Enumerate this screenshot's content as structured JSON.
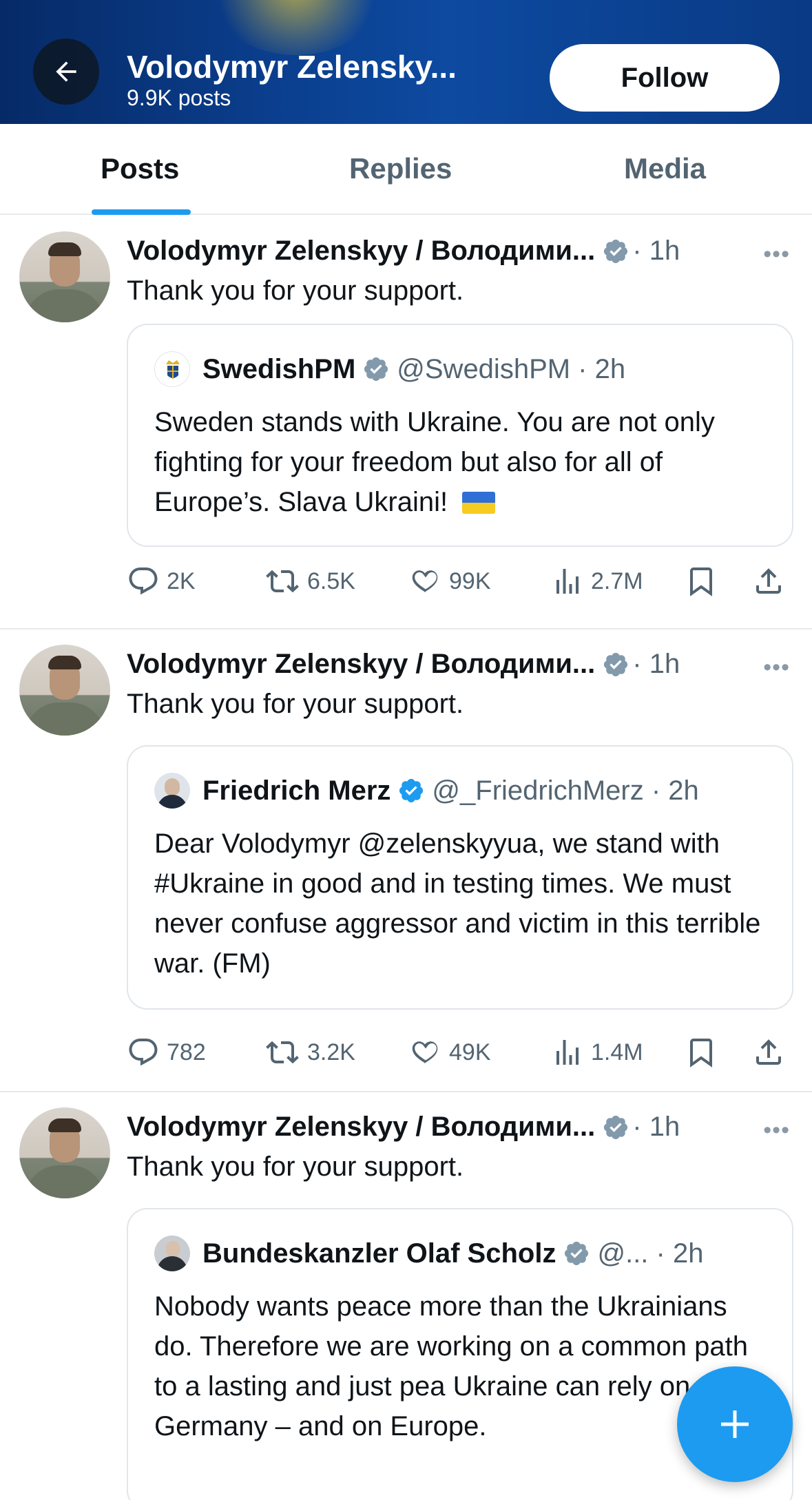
{
  "header": {
    "title": "Volodymyr Zelensky...",
    "posts_count": "9.9K posts",
    "follow_label": "Follow"
  },
  "tabs": [
    {
      "label": "Posts",
      "active": true
    },
    {
      "label": "Replies",
      "active": false
    },
    {
      "label": "Media",
      "active": false
    }
  ],
  "posts": [
    {
      "author": "Volodymyr Zelenskyy / Володими...",
      "time": "· 1h",
      "text": "Thank you for your support.",
      "quote": {
        "name": "SwedishPM",
        "handle": "@SwedishPM · 2h",
        "text": "Sweden stands with Ukraine. You are not only fighting for your freedom but also for all of Europe’s. Slava Ukraini!",
        "verified_color": "#829aab"
      },
      "stats": {
        "replies": "2K",
        "reposts": "6.5K",
        "likes": "99K",
        "views": "2.7M"
      }
    },
    {
      "author": "Volodymyr Zelenskyy / Володими...",
      "time": "· 1h",
      "text": "Thank you for your support.",
      "quote": {
        "name": "Friedrich Merz",
        "handle": "@_FriedrichMerz · 2h",
        "text": "Dear Volodymyr @zelenskyyua, we stand with #Ukraine in good and in testing times. We must never confuse aggressor and victim in this terrible war. (FM)",
        "verified_color": "#1d9bf0"
      },
      "stats": {
        "replies": "782",
        "reposts": "3.2K",
        "likes": "49K",
        "views": "1.4M"
      }
    },
    {
      "author": "Volodymyr Zelenskyy / Володими...",
      "time": "· 1h",
      "text": "Thank you for your support.",
      "quote": {
        "name": "Bundeskanzler Olaf Scholz",
        "handle": "@... · 2h",
        "text": "Nobody wants peace more than the Ukrainians do. Therefore we are working on a common path to a lasting and just pea Ukraine can rely on Germany – and on Europe.",
        "verified_color": "#829aab"
      }
    }
  ],
  "icons": {
    "back": "arrow-left-icon",
    "verified": "verified-badge-icon",
    "reply": "reply-icon",
    "repost": "repost-icon",
    "like": "heart-icon",
    "views": "views-icon",
    "bookmark": "bookmark-icon",
    "share": "share-icon",
    "compose": "plus-icon"
  },
  "colors": {
    "accent": "#1d9bf0",
    "header": "#0b3f8f",
    "verified_gray": "#829aab",
    "muted": "#536471"
  }
}
